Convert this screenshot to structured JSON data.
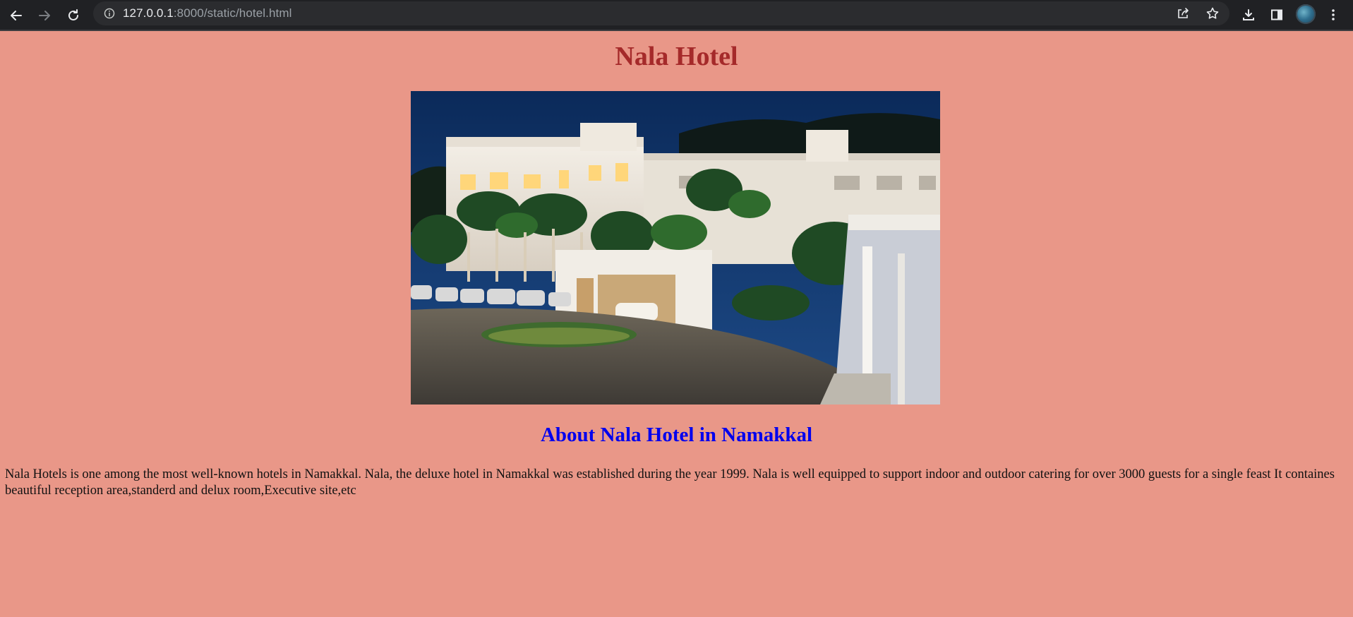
{
  "browser": {
    "url_host": "127.0.0.1",
    "url_rest": ":8000/static/hotel.html",
    "icons": [
      "back-arrow-icon",
      "forward-arrow-icon",
      "reload-icon",
      "site-info-icon",
      "share-icon",
      "bookmark-star-icon",
      "download-icon",
      "side-panel-icon",
      "profile-avatar",
      "kebab-menu-icon"
    ]
  },
  "page": {
    "title": "Nala Hotel",
    "subtitle": "About Nala Hotel in Namakkal",
    "description": "Nala Hotels is one among the most well-known hotels in Namakkal. Nala, the deluxe hotel in Namakkal was established during the year 1999. Nala is well equipped to support indoor and outdoor catering for over 3000 guests for a single feast It containes beautiful reception area,standerd and delux room,Executive site,etc"
  },
  "colors": {
    "page_background": "#e99788",
    "title": "#a52a2a",
    "subtitle": "#0000ee",
    "chrome": "#202124"
  }
}
